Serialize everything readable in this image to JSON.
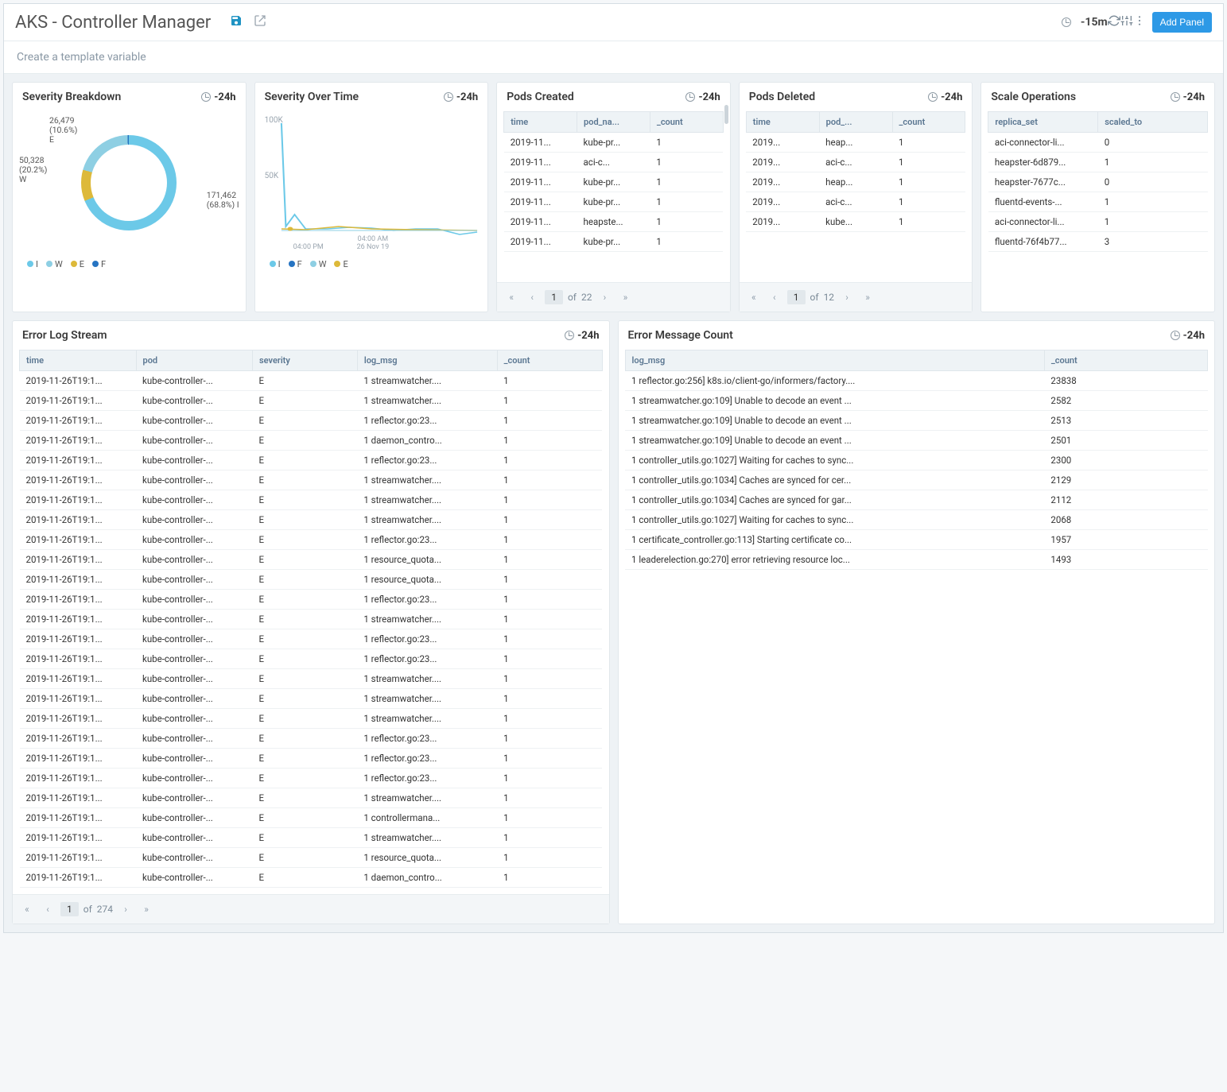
{
  "header": {
    "title": "AKS - Controller Manager",
    "time_range": "-15m",
    "add_panel": "Add Panel",
    "template_hint": "Create a template variable"
  },
  "colors": {
    "I": "#6cc9e8",
    "W": "#8ecfe3",
    "E": "#ddb93a",
    "F": "#2674c2"
  },
  "chart_data": [
    {
      "id": "severity_breakdown",
      "type": "pie",
      "title": "Severity Breakdown",
      "time_range": "-24h",
      "series": [
        {
          "name": "I",
          "value": 171462,
          "pct": 68.8
        },
        {
          "name": "E",
          "value": 26479,
          "pct": 10.6
        },
        {
          "name": "W",
          "value": 50328,
          "pct": 20.2
        },
        {
          "name": "F",
          "value": null,
          "pct": null
        }
      ],
      "legend": [
        "I",
        "W",
        "E",
        "F"
      ],
      "annotations": [
        {
          "text": "171,462\n(68.8%) I",
          "pos": "right"
        },
        {
          "text": "26,479\n(10.6%)\nE",
          "pos": "top-left"
        },
        {
          "text": "50,328\n(20.2%)\nW",
          "pos": "left"
        }
      ]
    },
    {
      "id": "severity_over_time",
      "type": "line",
      "title": "Severity Over Time",
      "time_range": "-24h",
      "ylim": [
        0,
        100000
      ],
      "yticks": [
        "100K",
        "50K"
      ],
      "xticks": [
        "04:00 PM",
        "04:00 AM"
      ],
      "xlabel": "26 Nov 19",
      "legend": [
        "I",
        "F",
        "W",
        "E"
      ],
      "series": [
        {
          "name": "I",
          "color": "#6cc9e8",
          "approx_peak": 98000,
          "note": "spike early then near 0"
        },
        {
          "name": "F",
          "color": "#2674c2",
          "approx_peak": 0
        },
        {
          "name": "W",
          "color": "#8ecfe3",
          "approx_peak": 12000
        },
        {
          "name": "E",
          "color": "#ddb93a",
          "approx_peak": 6000
        }
      ]
    }
  ],
  "pods_created": {
    "title": "Pods Created",
    "time_range": "-24h",
    "columns": [
      "time",
      "pod_na...",
      "_count"
    ],
    "rows": [
      [
        "2019-11...",
        "kube-pr...",
        "1"
      ],
      [
        "2019-11...",
        "aci-c...",
        "1"
      ],
      [
        "2019-11...",
        "kube-pr...",
        "1"
      ],
      [
        "2019-11...",
        "kube-pr...",
        "1"
      ],
      [
        "2019-11...",
        "heapste...",
        "1"
      ],
      [
        "2019-11...",
        "kube-pr...",
        "1"
      ]
    ],
    "pager": {
      "page": "1",
      "of_label": "of",
      "total": "22"
    }
  },
  "pods_deleted": {
    "title": "Pods Deleted",
    "time_range": "-24h",
    "columns": [
      "time",
      "pod_...",
      "_count"
    ],
    "rows": [
      [
        "2019...",
        "heap...",
        "1"
      ],
      [
        "2019...",
        "aci-c...",
        "1"
      ],
      [
        "2019...",
        "heap...",
        "1"
      ],
      [
        "2019...",
        "aci-c...",
        "1"
      ],
      [
        "2019...",
        "kube...",
        "1"
      ]
    ],
    "pager": {
      "page": "1",
      "of_label": "of",
      "total": "12"
    }
  },
  "scale_ops": {
    "title": "Scale Operations",
    "time_range": "-24h",
    "columns": [
      "replica_set",
      "scaled_to"
    ],
    "rows": [
      [
        "aci-connector-li...",
        "0"
      ],
      [
        "heapster-6d879...",
        "1"
      ],
      [
        "heapster-7677c...",
        "0"
      ],
      [
        "fluentd-events-...",
        "1"
      ],
      [
        "aci-connector-li...",
        "1"
      ],
      [
        "fluentd-76f4b77...",
        "3"
      ]
    ]
  },
  "error_log": {
    "title": "Error Log Stream",
    "time_range": "-24h",
    "columns": [
      "time",
      "pod",
      "severity",
      "log_msg",
      "_count"
    ],
    "rows": [
      [
        "2019-11-26T19:1...",
        "kube-controller-...",
        "E",
        "1 streamwatcher....",
        "1"
      ],
      [
        "2019-11-26T19:1...",
        "kube-controller-...",
        "E",
        "1 streamwatcher....",
        "1"
      ],
      [
        "2019-11-26T19:1...",
        "kube-controller-...",
        "E",
        "1 reflector.go:23...",
        "1"
      ],
      [
        "2019-11-26T19:1...",
        "kube-controller-...",
        "E",
        "1 daemon_contro...",
        "1"
      ],
      [
        "2019-11-26T19:1...",
        "kube-controller-...",
        "E",
        "1 reflector.go:23...",
        "1"
      ],
      [
        "2019-11-26T19:1...",
        "kube-controller-...",
        "E",
        "1 streamwatcher....",
        "1"
      ],
      [
        "2019-11-26T19:1...",
        "kube-controller-...",
        "E",
        "1 streamwatcher....",
        "1"
      ],
      [
        "2019-11-26T19:1...",
        "kube-controller-...",
        "E",
        "1 streamwatcher....",
        "1"
      ],
      [
        "2019-11-26T19:1...",
        "kube-controller-...",
        "E",
        "1 reflector.go:23...",
        "1"
      ],
      [
        "2019-11-26T19:1...",
        "kube-controller-...",
        "E",
        "1 resource_quota...",
        "1"
      ],
      [
        "2019-11-26T19:1...",
        "kube-controller-...",
        "E",
        "1 resource_quota...",
        "1"
      ],
      [
        "2019-11-26T19:1...",
        "kube-controller-...",
        "E",
        "1 reflector.go:23...",
        "1"
      ],
      [
        "2019-11-26T19:1...",
        "kube-controller-...",
        "E",
        "1 streamwatcher....",
        "1"
      ],
      [
        "2019-11-26T19:1...",
        "kube-controller-...",
        "E",
        "1 reflector.go:23...",
        "1"
      ],
      [
        "2019-11-26T19:1...",
        "kube-controller-...",
        "E",
        "1 reflector.go:23...",
        "1"
      ],
      [
        "2019-11-26T19:1...",
        "kube-controller-...",
        "E",
        "1 streamwatcher....",
        "1"
      ],
      [
        "2019-11-26T19:1...",
        "kube-controller-...",
        "E",
        "1 streamwatcher....",
        "1"
      ],
      [
        "2019-11-26T19:1...",
        "kube-controller-...",
        "E",
        "1 streamwatcher....",
        "1"
      ],
      [
        "2019-11-26T19:1...",
        "kube-controller-...",
        "E",
        "1 reflector.go:23...",
        "1"
      ],
      [
        "2019-11-26T19:1...",
        "kube-controller-...",
        "E",
        "1 reflector.go:23...",
        "1"
      ],
      [
        "2019-11-26T19:1...",
        "kube-controller-...",
        "E",
        "1 reflector.go:23...",
        "1"
      ],
      [
        "2019-11-26T19:1...",
        "kube-controller-...",
        "E",
        "1 streamwatcher....",
        "1"
      ],
      [
        "2019-11-26T19:1...",
        "kube-controller-...",
        "E",
        "1 controllermana...",
        "1"
      ],
      [
        "2019-11-26T19:1...",
        "kube-controller-...",
        "E",
        "1 streamwatcher....",
        "1"
      ],
      [
        "2019-11-26T19:1...",
        "kube-controller-...",
        "E",
        "1 resource_quota...",
        "1"
      ],
      [
        "2019-11-26T19:1...",
        "kube-controller-...",
        "E",
        "1 daemon_contro...",
        "1"
      ]
    ],
    "pager": {
      "page": "1",
      "of_label": "of",
      "total": "274"
    }
  },
  "error_msg": {
    "title": "Error Message Count",
    "time_range": "-24h",
    "columns": [
      "log_msg",
      "_count"
    ],
    "rows": [
      [
        "1 reflector.go:256] k8s.io/client-go/informers/factory....",
        "23838"
      ],
      [
        "1 streamwatcher.go:109] Unable to decode an event ...",
        "2582"
      ],
      [
        "1 streamwatcher.go:109] Unable to decode an event ...",
        "2513"
      ],
      [
        "1 streamwatcher.go:109] Unable to decode an event ...",
        "2501"
      ],
      [
        "1 controller_utils.go:1027] Waiting for caches to sync...",
        "2300"
      ],
      [
        "1 controller_utils.go:1034] Caches are synced for cer...",
        "2129"
      ],
      [
        "1 controller_utils.go:1034] Caches are synced for gar...",
        "2112"
      ],
      [
        "1 controller_utils.go:1027] Waiting for caches to sync...",
        "2068"
      ],
      [
        "1 certificate_controller.go:113] Starting certificate co...",
        "1957"
      ],
      [
        "1 leaderelection.go:270] error retrieving resource loc...",
        "1493"
      ]
    ]
  }
}
